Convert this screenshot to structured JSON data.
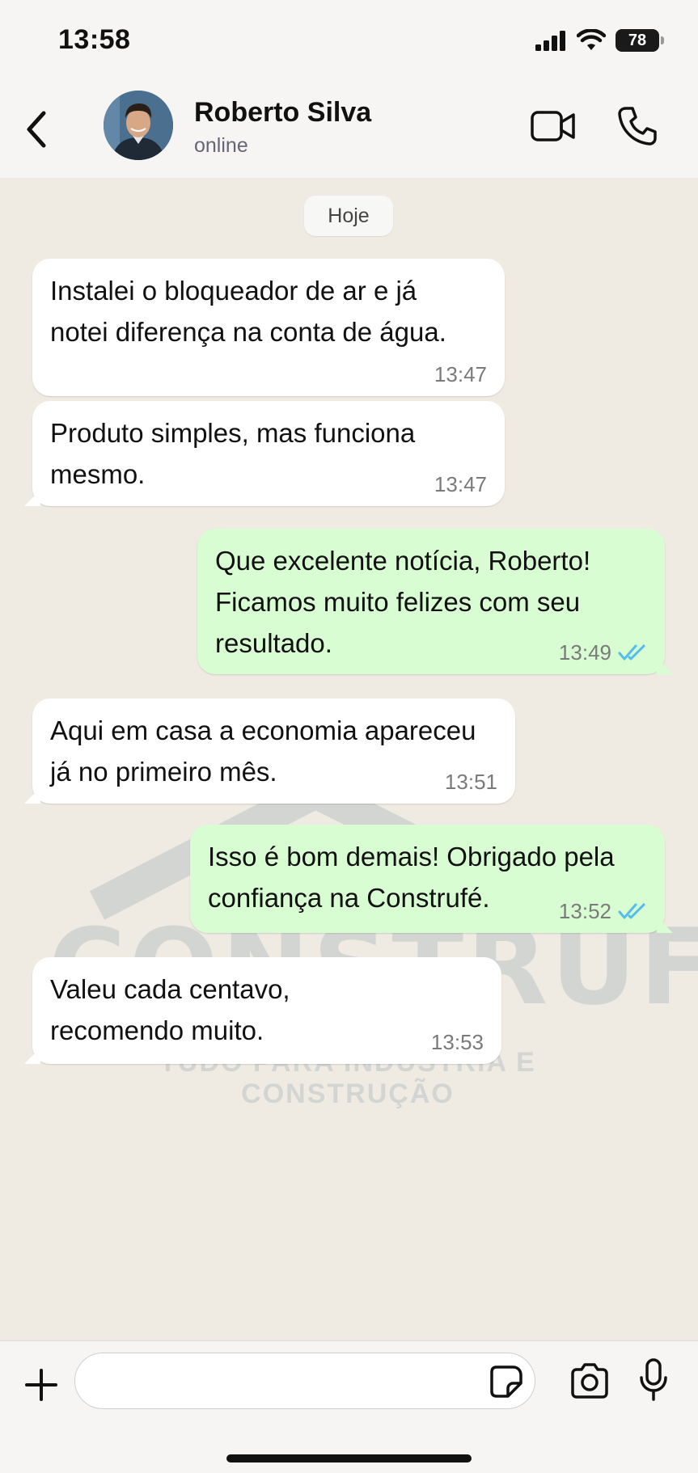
{
  "status_bar": {
    "time": "13:58",
    "battery": "78",
    "icons": [
      "signal-icon",
      "wifi-icon",
      "battery-icon"
    ]
  },
  "header": {
    "contact_name": "Roberto Silva",
    "contact_status": "online",
    "icons": [
      "back-icon",
      "avatar",
      "video-call-icon",
      "phone-icon"
    ]
  },
  "chat": {
    "date_label": "Hoje",
    "watermark": {
      "brand": "CONSTRUFÉ",
      "tagline": "TUDO PARA INDÚSTRIA E CONSTRUÇÃO"
    },
    "messages": [
      {
        "direction": "in",
        "text": "Instalei o bloqueador de ar e já notei diferença na conta de água.",
        "time": "13:47"
      },
      {
        "direction": "in",
        "text": "Produto simples, mas funciona mesmo.",
        "time": "13:47"
      },
      {
        "direction": "out",
        "text": "Que excelente notícia, Roberto! Ficamos muito felizes com seu resultado.",
        "time": "13:49",
        "status": "read"
      },
      {
        "direction": "in",
        "text": "Aqui em casa a economia apareceu já no primeiro mês.",
        "time": "13:51"
      },
      {
        "direction": "out",
        "text": "Isso é bom demais! Obrigado pela confiança na Construfé.",
        "time": "13:52",
        "status": "read"
      },
      {
        "direction": "in",
        "text": "Valeu cada centavo, recomendo muito.",
        "time": "13:53"
      }
    ]
  },
  "input_bar": {
    "placeholder": "",
    "icons": [
      "plus-icon",
      "sticker-icon",
      "camera-icon",
      "microphone-icon"
    ]
  },
  "colors": {
    "chat_background": "#efeae2",
    "incoming_bubble": "#ffffff",
    "outgoing_bubble": "#d9fdd3",
    "read_check": "#53bdeb"
  }
}
